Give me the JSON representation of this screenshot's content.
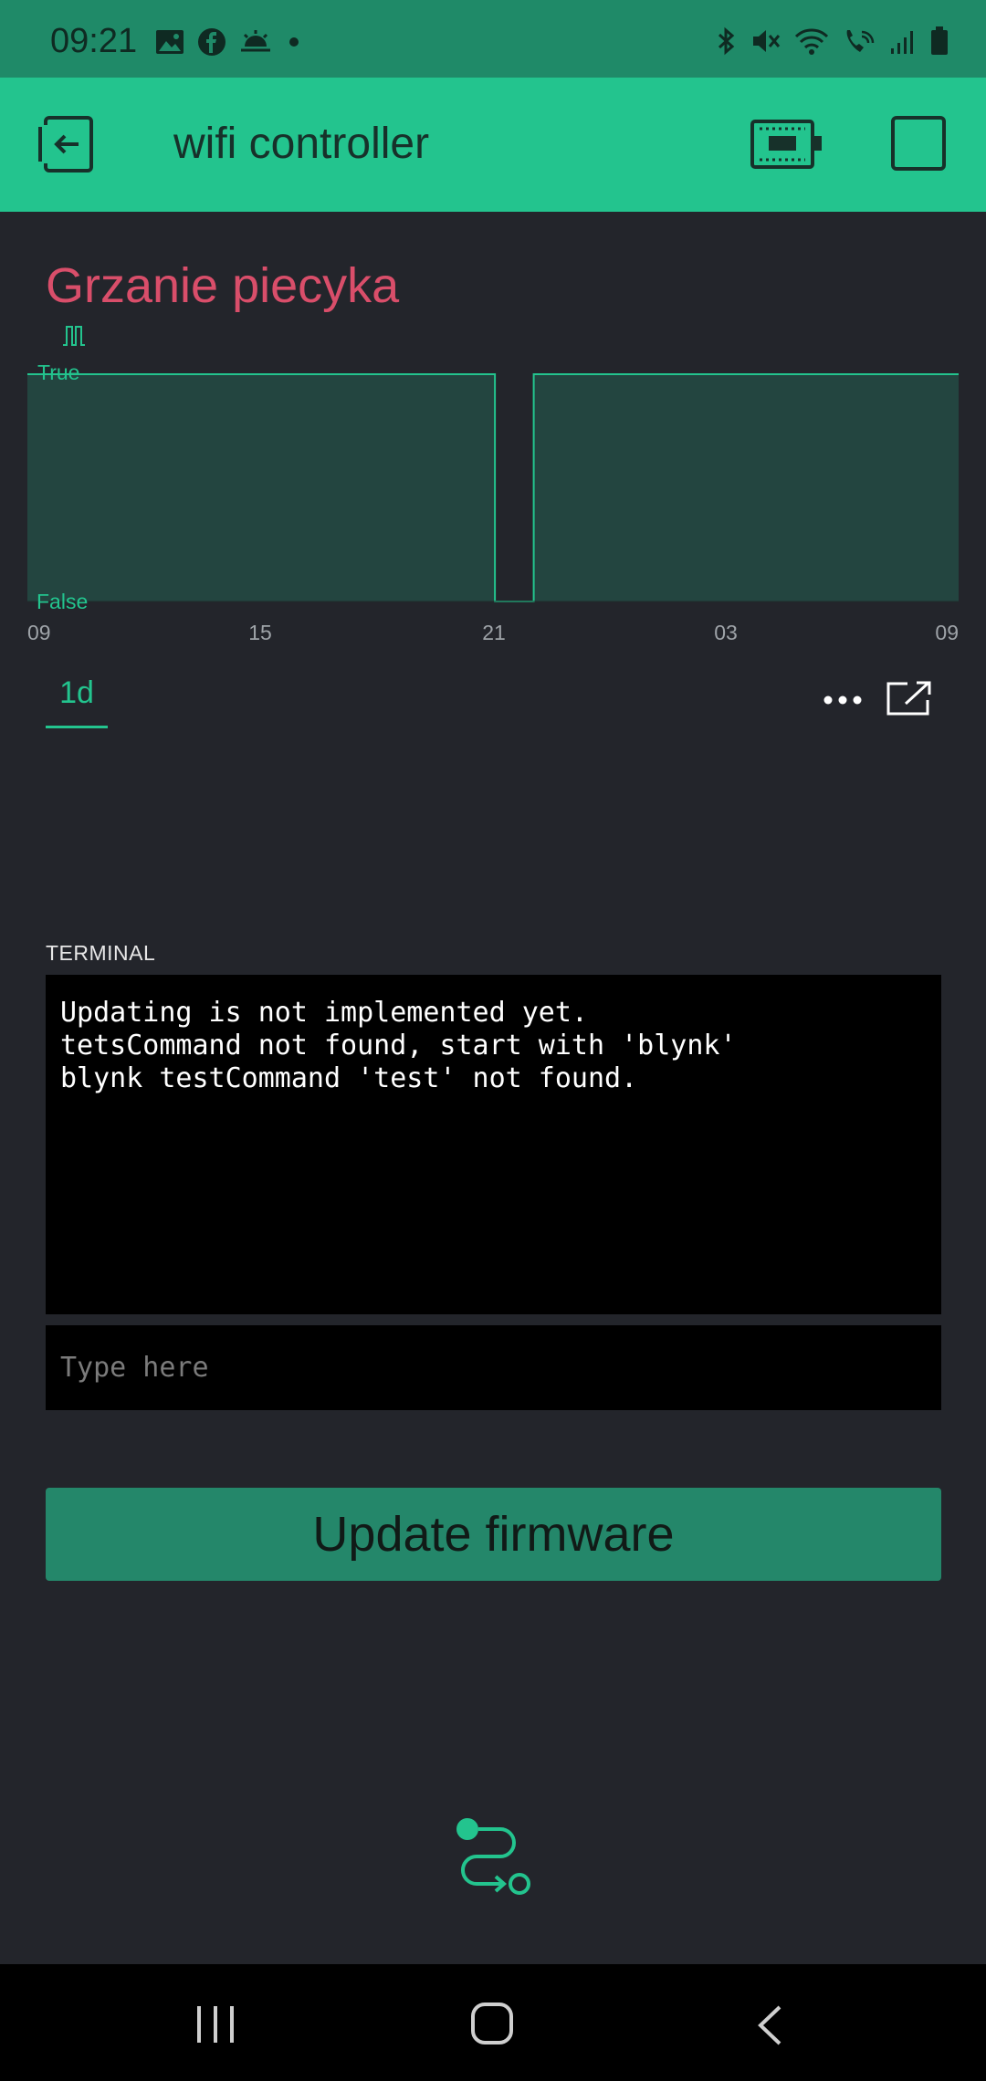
{
  "status_bar": {
    "time": "09:21",
    "left_icons": [
      "gallery-icon",
      "facebook-icon",
      "weather-icon",
      "dot-icon"
    ],
    "right_icons": [
      "bluetooth-icon",
      "mute-icon",
      "wifi-icon",
      "wifi-call-icon",
      "signal-icon",
      "battery-icon"
    ]
  },
  "app_bar": {
    "title": "wifi controller",
    "back_icon": "exit-icon",
    "device_icon": "device-chip-icon",
    "stop_icon": "square-icon"
  },
  "chart": {
    "title": "Grzanie piecyka",
    "wave_icon": "square-wave-icon",
    "range_tab": "1d",
    "menu_icon": "more-icon",
    "export_icon": "export-icon"
  },
  "chart_data": {
    "type": "area",
    "x_ticks": [
      "09",
      "15",
      "21",
      "03",
      "09"
    ],
    "y_ticks": [
      "False",
      "True"
    ],
    "ylim": [
      0,
      1
    ],
    "series": [
      {
        "values": [
          {
            "t": 0,
            "v": 1
          },
          {
            "t": 12.05,
            "v": 1
          },
          {
            "t": 12.05,
            "v": 0
          },
          {
            "t": 13.05,
            "v": 0
          },
          {
            "t": 13.05,
            "v": 1
          },
          {
            "t": 24,
            "v": 1
          }
        ]
      }
    ],
    "colors": {
      "line": "#23c48e",
      "fill": "#234540"
    },
    "grid": false
  },
  "terminal": {
    "label": "TERMINAL",
    "lines": "Updating is not implemented yet.\ntetsCommand not found, start with 'blynk'\nblynk testCommand 'test' not found.",
    "placeholder": "Type here"
  },
  "update_button": {
    "label": "Update firmware"
  },
  "colors": {
    "accent": "#23c48e",
    "status_bar": "#1f8a68",
    "background": "#23252b",
    "title_red": "#d94e6a",
    "button": "#24876a"
  }
}
